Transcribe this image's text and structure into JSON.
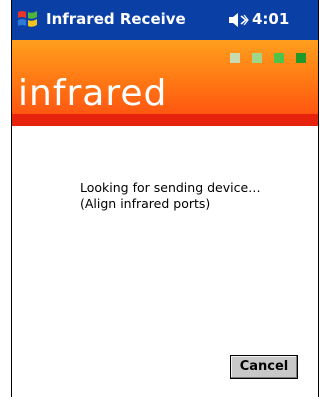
{
  "taskbar": {
    "title": "Infrared Receive",
    "time": "4:01",
    "start_icon": "windows-flag-icon",
    "volume_icon": "speaker-icon"
  },
  "banner": {
    "logo_text": "infrared",
    "signal_dot_icons": [
      "signal-dot",
      "signal-dot",
      "signal-dot",
      "signal-dot"
    ],
    "signal_dot_colors": [
      "#c9d9b0",
      "#9fd68a",
      "#4cc44c",
      "#1f9a2a"
    ]
  },
  "message": {
    "line1": "Looking for sending device…",
    "line2": "(Align infrared ports)"
  },
  "buttons": {
    "cancel_label": "Cancel"
  },
  "colors": {
    "taskbar": "#0a3fa6",
    "banner_top": "#ff9f1e",
    "banner_bottom": "#e8230d",
    "button_face": "#c8c8c8"
  }
}
